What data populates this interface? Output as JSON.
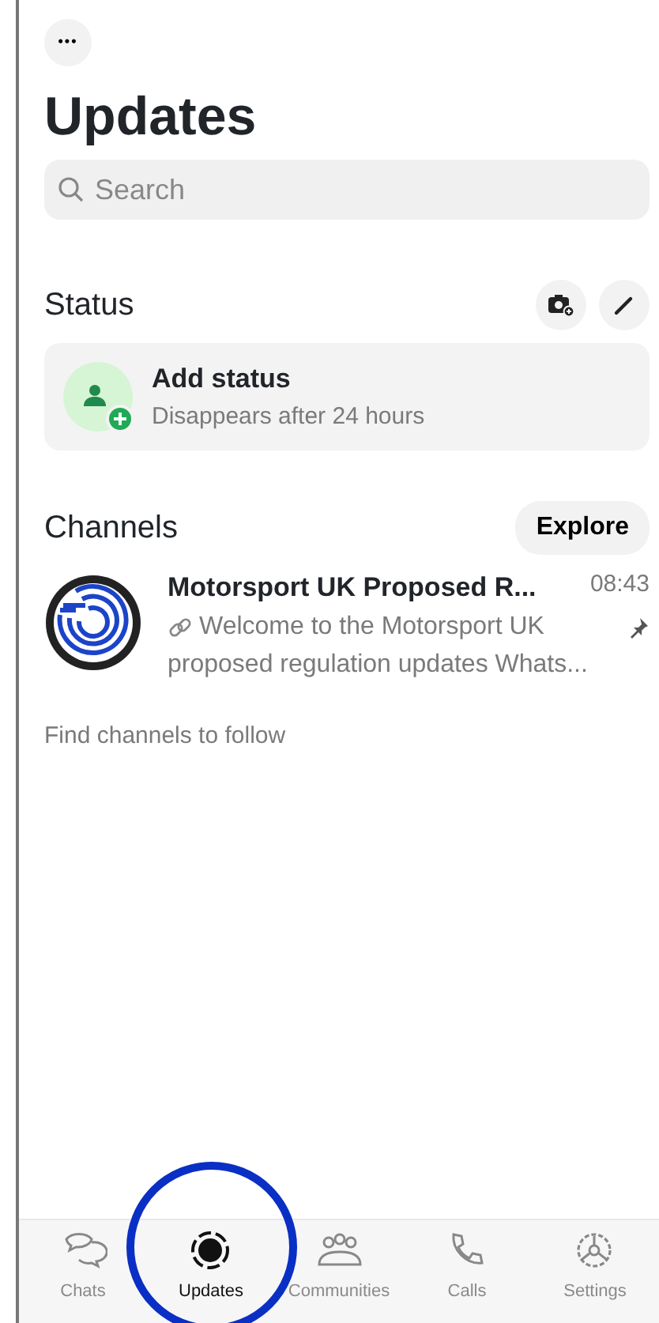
{
  "more_button": {
    "label": "•••"
  },
  "title": "Updates",
  "search": {
    "placeholder": "Search"
  },
  "status": {
    "heading": "Status",
    "add_title": "Add status",
    "add_subtitle": "Disappears after 24 hours"
  },
  "channels": {
    "heading": "Channels",
    "explore": "Explore",
    "items": [
      {
        "name": "Motorsport UK Proposed R...",
        "time": "08:43",
        "preview_line_1": "Welcome to the Motorsport UK",
        "preview_line_2": "proposed regulation updates Whats...",
        "pinned": true
      }
    ],
    "find_link": "Find channels to follow"
  },
  "tabs": [
    {
      "label": "Chats",
      "kind": "chats",
      "selected": false,
      "circled": false
    },
    {
      "label": "Updates",
      "kind": "updates",
      "selected": true,
      "circled": true
    },
    {
      "label": "Communities",
      "kind": "communities",
      "selected": false,
      "circled": false
    },
    {
      "label": "Calls",
      "kind": "calls",
      "selected": false,
      "circled": false
    },
    {
      "label": "Settings",
      "kind": "settings",
      "selected": false,
      "circled": false
    }
  ],
  "annotation": {
    "kind": "circle",
    "color": "#0a2fc4"
  }
}
